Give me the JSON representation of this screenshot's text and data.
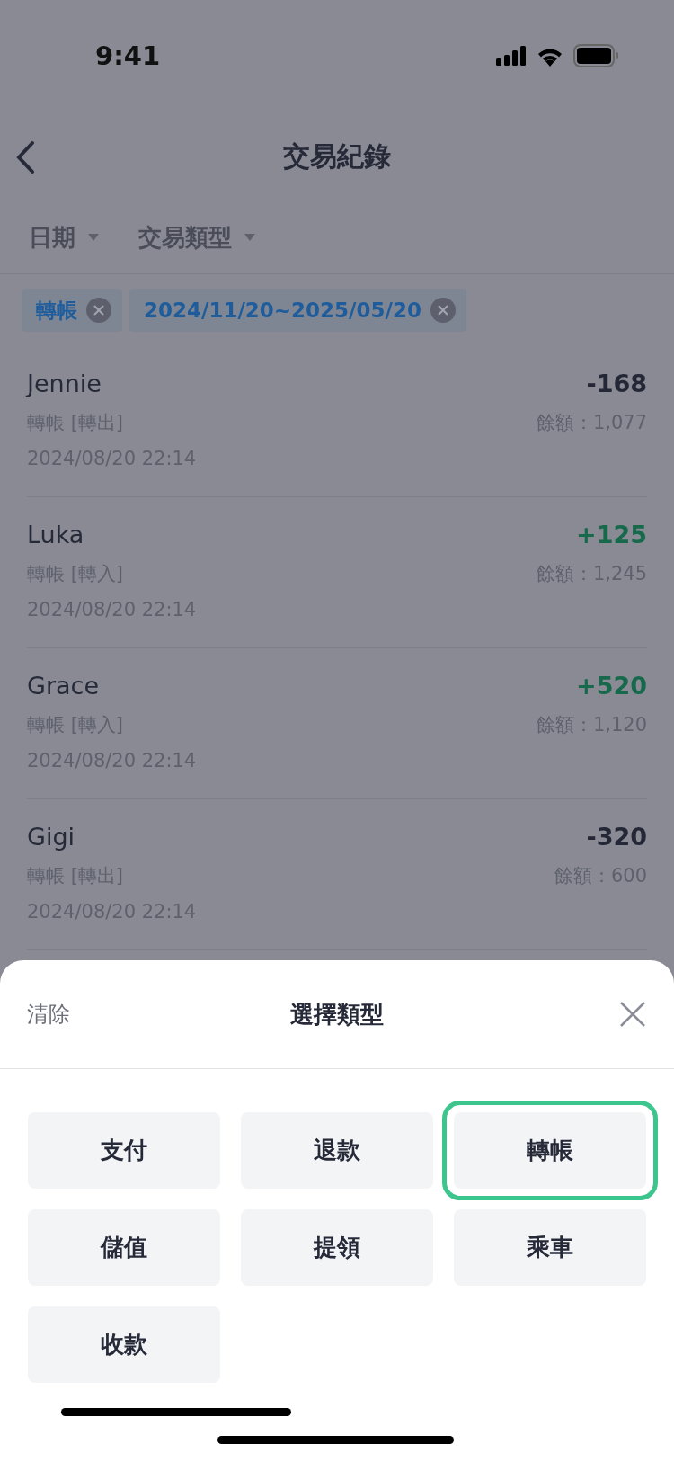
{
  "status_bar": {
    "time": "9:41"
  },
  "header": {
    "title": "交易紀錄"
  },
  "filters": [
    {
      "label": "日期"
    },
    {
      "label": "交易類型"
    }
  ],
  "chips": [
    {
      "label": "轉帳"
    },
    {
      "label": "2024/11/20~2025/05/20"
    }
  ],
  "transactions": [
    {
      "name": "Jennie",
      "type": "轉帳 [轉出]",
      "time": "2024/08/20 22:14",
      "amount": "-168",
      "color": "#232736",
      "balance": "餘額：1,077"
    },
    {
      "name": "Luka",
      "type": "轉帳 [轉入]",
      "time": "2024/08/20 22:14",
      "amount": "+125",
      "color": "#16694a",
      "balance": "餘額：1,245"
    },
    {
      "name": "Grace",
      "type": "轉帳 [轉入]",
      "time": "2024/08/20 22:14",
      "amount": "+520",
      "color": "#16694a",
      "balance": "餘額：1,120"
    },
    {
      "name": "Gigi",
      "type": "轉帳 [轉出]",
      "time": "2024/08/20 22:14",
      "amount": "-320",
      "color": "#232736",
      "balance": "餘額：600"
    }
  ],
  "sheet": {
    "clear": "清除",
    "title": "選擇類型",
    "options": [
      {
        "label": "支付",
        "selected": false
      },
      {
        "label": "退款",
        "selected": false
      },
      {
        "label": "轉帳",
        "selected": true
      },
      {
        "label": "儲值",
        "selected": false
      },
      {
        "label": "提領",
        "selected": false
      },
      {
        "label": "乘車",
        "selected": false
      },
      {
        "label": "收款",
        "selected": false
      }
    ]
  }
}
